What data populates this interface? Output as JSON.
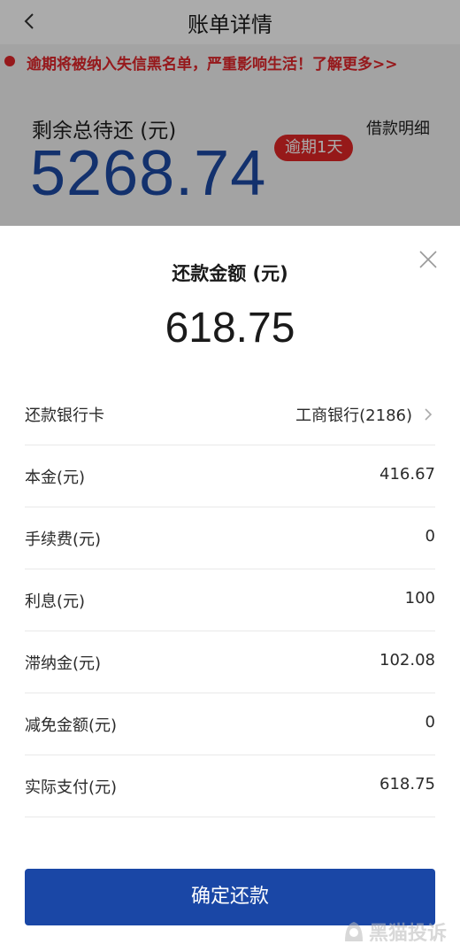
{
  "header": {
    "title": "账单详情"
  },
  "background": {
    "warning_text": "逾期将被纳入失信黑名单，严重影响生活！了解更多>>",
    "remaining_label": "剩余总待还 (元)",
    "remaining_amount": "5268.74",
    "overdue_badge": "逾期1天",
    "loan_detail_link": "借款明细"
  },
  "sheet": {
    "title": "还款金额 (元)",
    "amount": "618.75",
    "rows": [
      {
        "label": "还款银行卡",
        "value": "工商银行(2186)"
      },
      {
        "label": "本金(元)",
        "value": "416.67"
      },
      {
        "label": "手续费(元)",
        "value": "0"
      },
      {
        "label": "利息(元)",
        "value": "100"
      },
      {
        "label": "滞纳金(元)",
        "value": "102.08"
      },
      {
        "label": "减免金额(元)",
        "value": "0"
      },
      {
        "label": "实际支付(元)",
        "value": "618.75"
      }
    ],
    "confirm_label": "确定还款"
  },
  "watermark": {
    "text": "黑猫投诉"
  },
  "icons": {
    "back": "chevron-left-icon",
    "close": "close-icon",
    "bank_arrow": "chevron-right-icon"
  },
  "colors": {
    "accent_blue": "#1a47a6",
    "amount_blue": "#1d4aa3",
    "warning_red": "#e0262a",
    "badge_red": "#e02626"
  }
}
